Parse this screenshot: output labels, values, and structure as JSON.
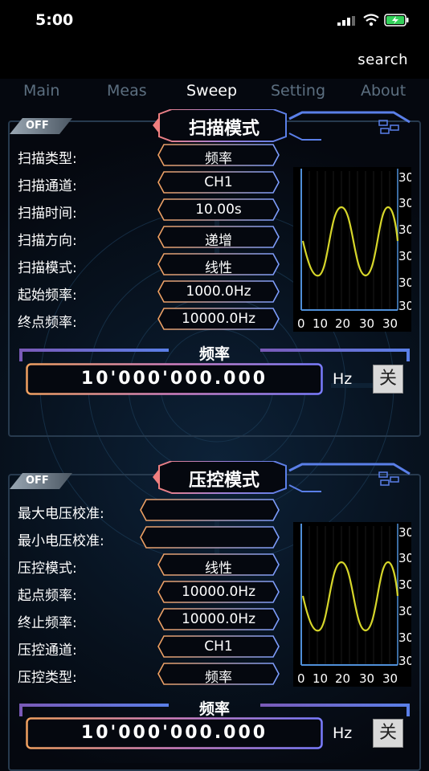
{
  "status": {
    "time": "5:00"
  },
  "nav": {
    "search": "search"
  },
  "tabs": [
    {
      "label": "Main"
    },
    {
      "label": "Meas"
    },
    {
      "label": "Sweep"
    },
    {
      "label": "Setting"
    },
    {
      "label": "About"
    }
  ],
  "sweep": {
    "off": "OFF",
    "title": "扫描模式",
    "rows": [
      {
        "label": "扫描类型:",
        "value": "频率"
      },
      {
        "label": "扫描通道:",
        "value": "CH1"
      },
      {
        "label": "扫描时间:",
        "value": "10.00s"
      },
      {
        "label": "扫描方向:",
        "value": "递增"
      },
      {
        "label": "扫描模式:",
        "value": "线性"
      },
      {
        "label": "起始频率:",
        "value": "1000.0Hz"
      },
      {
        "label": "终点频率:",
        "value": "10000.0Hz"
      }
    ],
    "chart": {
      "y_ticks": [
        "30",
        "30",
        "30",
        "30",
        "30",
        "30"
      ],
      "x_ticks": [
        "0",
        "10",
        "20",
        "30",
        "30"
      ]
    },
    "freq_label": "频率",
    "freq_value": "10'000'000.000",
    "unit": "Hz",
    "close": "关"
  },
  "vc": {
    "off": "OFF",
    "title": "压控模式",
    "rows": [
      {
        "label": "最大电压校准:",
        "value": ""
      },
      {
        "label": "最小电压校准:",
        "value": ""
      },
      {
        "label": "压控模式:",
        "value": "线性"
      },
      {
        "label": "起点频率:",
        "value": "10000.0Hz"
      },
      {
        "label": "终止频率:",
        "value": "10000.0Hz"
      },
      {
        "label": "压控通道:",
        "value": "CH1"
      },
      {
        "label": "压控类型:",
        "value": "频率"
      }
    ],
    "chart": {
      "y_ticks": [
        "30",
        "30",
        "30",
        "30",
        "30",
        "30"
      ],
      "x_ticks": [
        "0",
        "10",
        "20",
        "30",
        "30"
      ]
    },
    "freq_label": "频率",
    "freq_value": "10'000'000.000",
    "unit": "Hz",
    "close": "关"
  },
  "colors": {
    "field_left": "#f0a060",
    "field_right": "#7a9cff",
    "wave": "#d6d62a",
    "axis": "#4f8fd8"
  }
}
